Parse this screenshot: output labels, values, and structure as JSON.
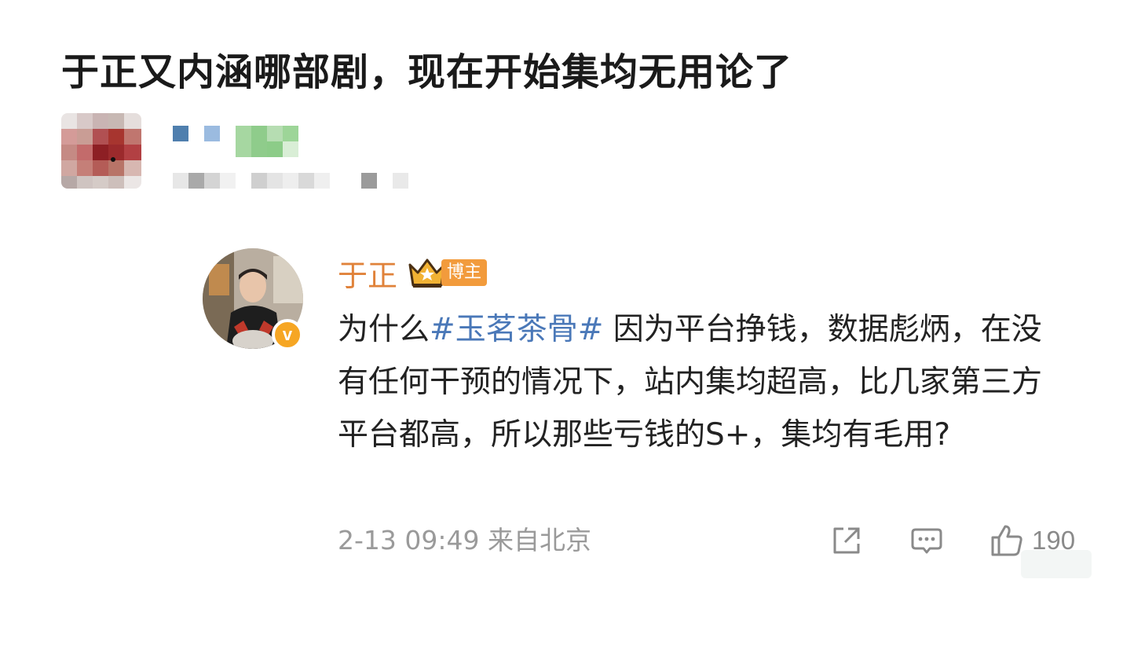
{
  "post": {
    "title": "于正又内涵哪部剧，现在开始集均无用论了"
  },
  "comment": {
    "author": "于正",
    "badge_label": "博主",
    "verified_mark": "v",
    "text_before": "为什么",
    "hashtag": "#玉茗茶骨#",
    "text_after": " 因为平台挣钱，数据彪炳，在没有任何干预的情况下，站内集均超高，比几家第三方平台都高，所以那些亏钱的S+，集均有毛用?",
    "timestamp": "2-13 09:49 来自北京",
    "like_count": "190"
  },
  "icons": {
    "share": "share-icon",
    "comment": "comment-icon",
    "like": "thumbs-up-icon",
    "crown": "crown-icon"
  },
  "colors": {
    "author": "#e0823a",
    "hashtag": "#4a78b8",
    "badge": "#f29b3c",
    "verified": "#f6a623",
    "meta": "#9a9a9a"
  }
}
